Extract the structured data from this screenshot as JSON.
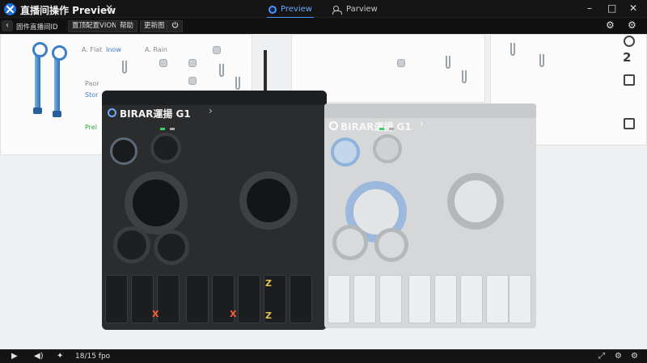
{
  "window": {
    "title": "直播间操作 Preview",
    "close": "✕"
  },
  "mode_tabs": [
    {
      "label": "Preview",
      "active": true
    },
    {
      "label": "Parview",
      "active": false
    }
  ],
  "window_controls": {
    "minimize": "–",
    "maximize": "□",
    "close": "✕",
    "settings": "⚙"
  },
  "toolbar": {
    "back": "‹",
    "items": [
      "固件直播间ID",
      "置顶配置VION",
      "帮助",
      "更新图"
    ]
  },
  "board_labels": {
    "a_right": "A. Flat",
    "a_mid": "Inow",
    "a_far": "A. Rain",
    "p_left": "Paor",
    "s_left": "Stor",
    "f_left": "Prel"
  },
  "right_panel": {
    "digit": "2"
  },
  "devices": {
    "dark": {
      "title": "BIRAR運揚 G1",
      "chevron": "›",
      "marks": [
        "X",
        "X",
        "Z",
        "Z"
      ]
    },
    "light": {
      "title": "BIRAR運揚 G1",
      "chevron": "›"
    }
  },
  "playback": {
    "play": "▶",
    "volume": "◀)",
    "mode": "✦",
    "counter": "18/15 fpo",
    "fullscreen": "⤢",
    "settings": "⚙"
  },
  "colors": {
    "accent": "#4d94ff",
    "dark_device": "#2a2c2d",
    "light_device": "#d5d7d8",
    "blue_part": "#8fb3dd",
    "red_mark": "#ff5a3c"
  }
}
